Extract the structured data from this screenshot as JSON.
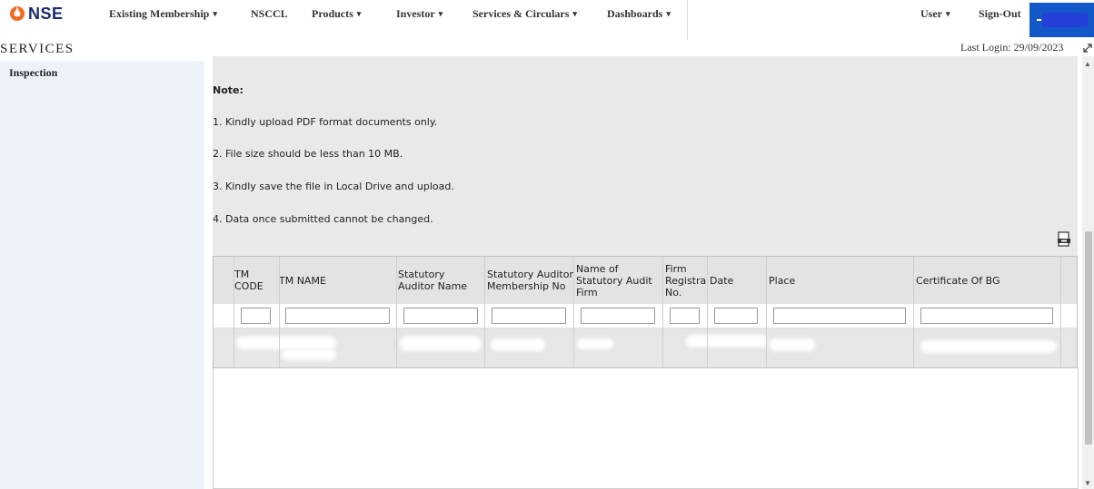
{
  "header": {
    "logo_text": "NSE",
    "nav": [
      {
        "label": "Existing Membership",
        "caret": "▾"
      },
      {
        "label": "NSCCL",
        "caret": ""
      },
      {
        "label": "Products",
        "caret": "▾"
      },
      {
        "label": "Investor",
        "caret": "▾"
      },
      {
        "label": "Services & Circulars",
        "caret": "▾"
      },
      {
        "label": "Dashboards",
        "caret": "▾"
      },
      {
        "label": "User",
        "caret": "▾"
      },
      {
        "label": "Sign-Out",
        "caret": ""
      }
    ]
  },
  "section_title": "SERVICES",
  "last_login": "Last Login: 29/09/2023",
  "sidebar": {
    "items": [
      {
        "label": "Inspection"
      }
    ]
  },
  "notes": {
    "title": "Note:",
    "lines": [
      "1. Kindly upload PDF format documents only.",
      "2. File size should be less than 10 MB.",
      "3. Kindly save the file in Local Drive and upload.",
      "4. Data once submitted cannot be changed."
    ]
  },
  "table": {
    "columns": [
      "TM CODE",
      "TM NAME",
      "Statutory Auditor Name",
      "Statutory Auditor Membership No",
      "Name of Statutory Audit Firm",
      "Firm Registrati No.",
      "Date",
      "Place",
      "Certificate Of BG"
    ]
  },
  "colors": {
    "brand": "#1a2a6c",
    "logo_accent": "#f26b21",
    "user_box": "#1358c9",
    "sidebar_bg": "#eef3fb",
    "panel_bg": "#e9e9e9"
  },
  "icons": {
    "logo": "nse-logo-icon",
    "export": "pdf-export-icon",
    "resize": "resize-icon",
    "caret": "chevron-down-icon"
  }
}
